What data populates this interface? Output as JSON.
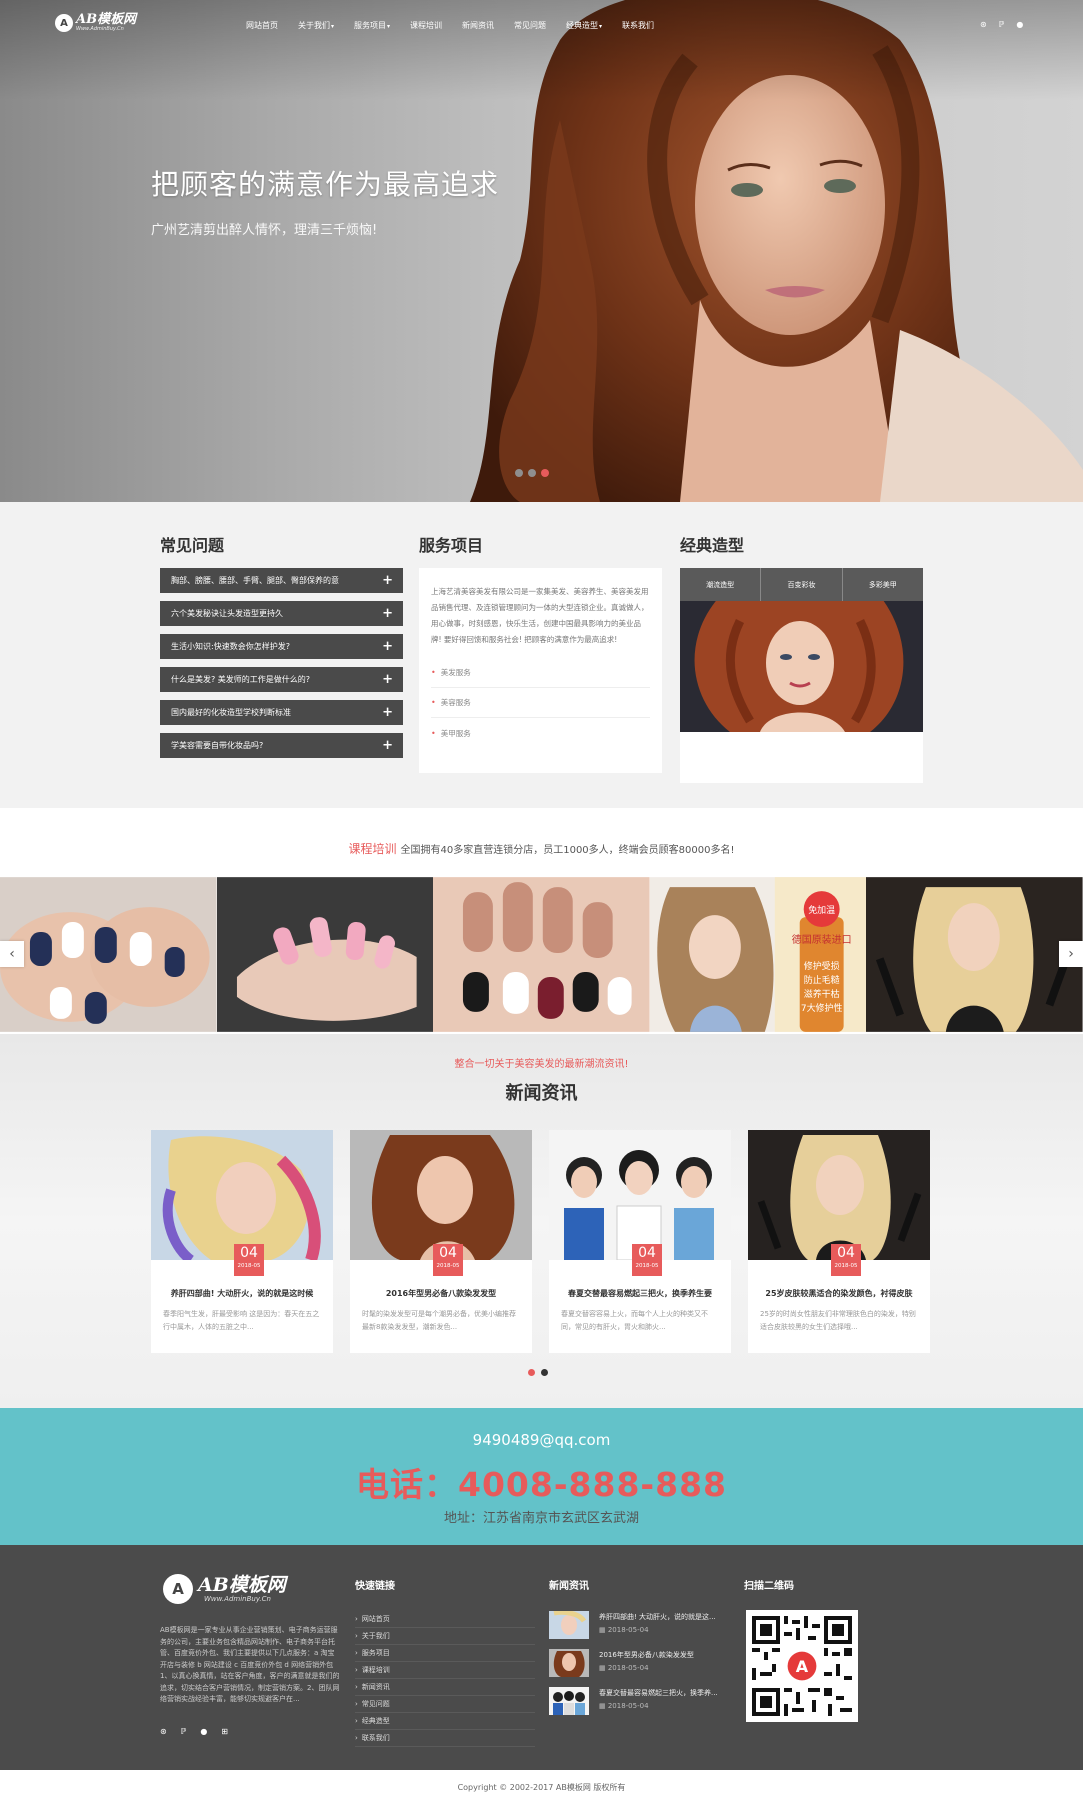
{
  "brand": {
    "logo_main": "AB模板网",
    "logo_sub": "Www.AdminBuy.Cn"
  },
  "nav": {
    "items": [
      "网站首页",
      "关于我们",
      "服务项目",
      "课程培训",
      "新闻资讯",
      "常见问题",
      "经典造型",
      "联系我们"
    ],
    "dropdown_flags": [
      false,
      true,
      true,
      false,
      false,
      false,
      true,
      false
    ],
    "icons": [
      "weibo-icon",
      "paypal-icon",
      "qq-icon"
    ]
  },
  "hero": {
    "title": "把顾客的满意作为最高追求",
    "subtitle": "广州艺清剪出醉人情怀，理清三千烦恼!",
    "slides": 3,
    "active_slide": 3
  },
  "faq": {
    "title": "常见问题",
    "items": [
      "胸部、膀腰、腰部、手臂、腿部、臀部保养的意",
      "六个美发秘诀让头发造型更持久",
      "生活小知识:快速数会你怎样护发?",
      "什么是美发? 美发师的工作是做什么的?",
      "国内最好的化妆造型学校判断标准",
      "学美容需要自带化妆品吗?"
    ]
  },
  "services": {
    "title": "服务项目",
    "description": "上海艺清美容美发有限公司是一家集美发、美容养生、美容美发用品销售代理、及连锁管理顾问为一体的大型连锁企业。真诚做人，用心做事，时刻感恩，快乐生活，创建中国最具影响力的美业品牌! 要好得回馈和服务社会! 把顾客的满意作为最高追求!",
    "items": [
      "美发服务",
      "美容服务",
      "美甲服务"
    ]
  },
  "styles": {
    "title": "经典造型",
    "tabs": [
      "潮流造型",
      "百变彩妆",
      "多彩美甲"
    ]
  },
  "courses": {
    "accent": "课程培训",
    "text": "全国拥有40多家直营连锁分店，员工1000多人，终端会员顾客80000多名!",
    "promo_badge": "免加温",
    "promo_title": "德国原装进口",
    "promo_lines": [
      "修护受损",
      "防止毛糙",
      "滋养干枯",
      "7大修护性"
    ]
  },
  "news": {
    "tagline": "整合一切关于美容美发的最新潮流资讯!",
    "title": "新闻资讯",
    "cards": [
      {
        "day": "04",
        "ym": "2018-05",
        "title": "养肝四部曲! 大动肝火，说的就是这时候",
        "excerpt": "春季阳气生发，肝最受影响 这是因为：春天在五之行中属木，人体的五脏之中..."
      },
      {
        "day": "04",
        "ym": "2018-05",
        "title": "2016年型男必备八款染发发型",
        "excerpt": "时髦的染发发型可是每个潮男必备，优美小编推荐最新8款染发发型，潮新发色..."
      },
      {
        "day": "04",
        "ym": "2018-05",
        "title": "春夏交替最容易燃起三把火，换季养生要",
        "excerpt": "春夏交替容容易上火，而每个人上火的种类又不同，常见的有肝火，胃火和肺火..."
      },
      {
        "day": "04",
        "ym": "2018-05",
        "title": "25岁皮肤较黑适合的染发颜色，衬得皮肤",
        "excerpt": "25岁的时尚女性朋友们非常理肤色白的染发，特别适合皮肤较黑的女生们选择哦..."
      }
    ],
    "pages": 2,
    "active_page": 1
  },
  "contact": {
    "email": "9490489@qq.com",
    "phone": "电话：4008-888-888",
    "address": "地址：江苏省南京市玄武区玄武湖"
  },
  "footer": {
    "logo_main": "AB模板网",
    "logo_sub": "Www.AdminBuy.Cn",
    "about": "AB模板网是一家专业从事企业营销策划、电子商务运营服务的公司，主要业务包含精品网站制作、电子商务平台托管、百度竞价外包、我们主要提供以下几点服务：a 淘宝开店与装修 b 网站建设 c 百度竞价外包 d 网络营销外包 1、以真心换真情，站在客户角度，客户的满意就是我们的追求，切实结合客户营销情况，制定营销方案。2、团队网络营销实战经验丰富，能够切实规避客户在...",
    "social": [
      "weibo-icon",
      "paypal-icon",
      "qq-icon",
      "cart-icon"
    ],
    "links_title": "快速链接",
    "links": [
      "网站首页",
      "关于我们",
      "服务项目",
      "课程培训",
      "新闻资讯",
      "常见问题",
      "经典造型",
      "联系我们"
    ],
    "news_title": "新闻资讯",
    "news": [
      {
        "title": "养肝四部曲! 大动肝火，说的就是这...",
        "date": "2018-05-04"
      },
      {
        "title": "2016年型男必备八款染发发型",
        "date": "2018-05-04"
      },
      {
        "title": "春夏交替最容易燃起三把火，换季养...",
        "date": "2018-05-04"
      }
    ],
    "qr_title": "扫描二维码",
    "copyright": "Copyright © 2002-2017 AB模板网 版权所有"
  },
  "colors": {
    "accent": "#e75b5b",
    "teal": "#63c2c9",
    "footer_bg": "#4b4b4b",
    "dark_bar": "#4a4a4a"
  }
}
